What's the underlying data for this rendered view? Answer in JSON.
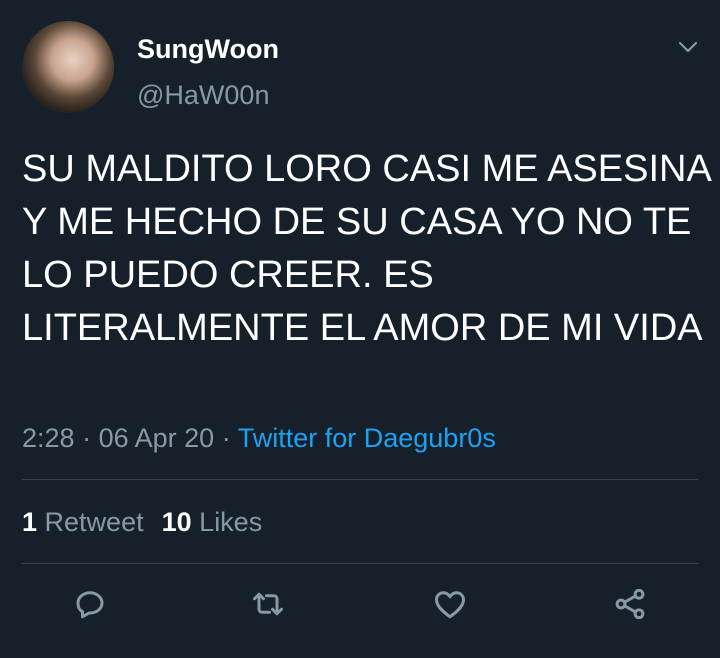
{
  "user": {
    "display_name": "SungWoon",
    "handle": "@HaW00n"
  },
  "tweet": {
    "text": "SU MALDITO LORO CASI ME ASESINA Y ME HECHO DE SU CASA YO NO TE LO PUEDO CREER. ES LITERALMENTE EL AMOR DE MI VIDA",
    "time": "2:28",
    "separator": "·",
    "date": "06 Apr 20",
    "source": "Twitter for Daegubr0s"
  },
  "stats": {
    "retweets_count": "1",
    "retweets_label": "Retweet",
    "likes_count": "10",
    "likes_label": "Likes"
  },
  "icons": {
    "menu": "chevron-down-icon",
    "reply": "reply-icon",
    "retweet": "retweet-icon",
    "like": "heart-icon",
    "share": "share-icon"
  },
  "colors": {
    "background": "#15202b",
    "text_primary": "#ffffff",
    "text_secondary": "#8899a6",
    "link": "#1da1f2",
    "divider": "#38444d"
  }
}
